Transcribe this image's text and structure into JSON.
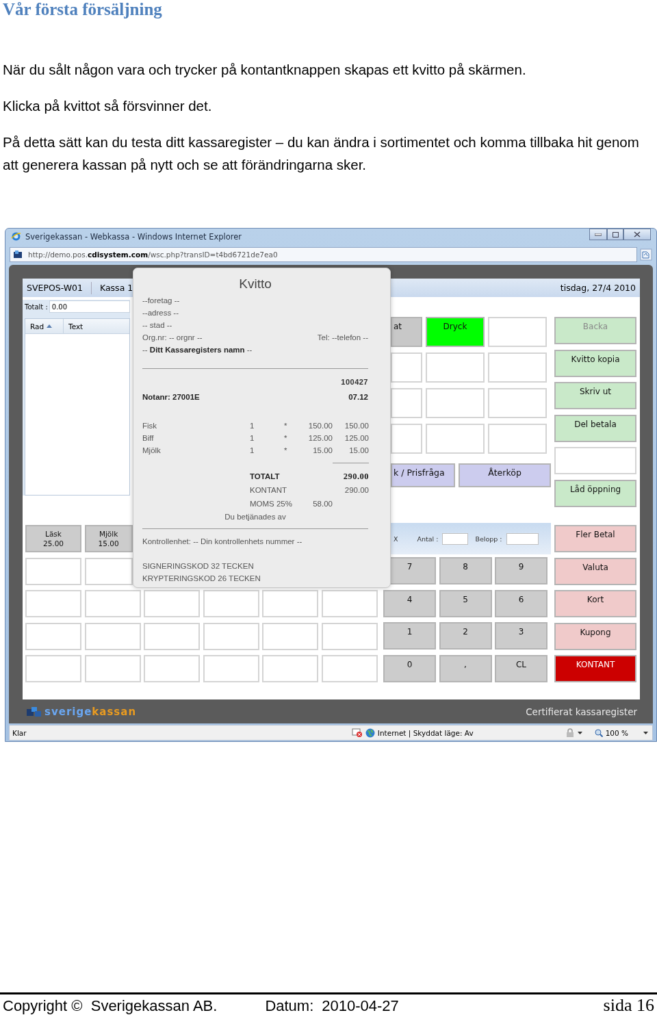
{
  "heading": "Vår första försäljning",
  "paragraphs": [
    "När du sålt någon vara och trycker på kontantknappen skapas ett kvitto på skärmen.",
    "Klicka på kvittot så försvinner det.",
    "På detta sätt kan du testa ditt kassaregister – du kan ändra i sortimentet och komma tillbaka hit genom att generera kassan på nytt och se att förändringarna sker."
  ],
  "browser": {
    "title": "Sverigekassan - Webkassa - Windows Internet Explorer",
    "address": "http://demo.pos.**cdisystem.com**/wsc.php?transID=t4bd6721de7ea0",
    "status": {
      "text": "Klar",
      "zone": "Internet | Skyddat läge: Av",
      "zoom": "100 %"
    }
  },
  "app": {
    "header": {
      "station": "SVEPOS-W01",
      "register": "Kassa 1",
      "date": "tisdag, 27/4 2010"
    },
    "total": {
      "label": "Totalt :",
      "value": "0.00"
    },
    "columns": [
      {
        "label": "Rad",
        "sorted": true
      },
      {
        "label": "Text",
        "sorted": false
      }
    ],
    "categories": [
      [
        {
          "label": "at",
          "kind": "category"
        },
        {
          "label": "Dryck",
          "kind": "active"
        },
        {
          "kind": "empty"
        }
      ],
      [
        {
          "kind": "empty"
        },
        {
          "kind": "empty"
        },
        {
          "kind": "empty"
        }
      ],
      [
        {
          "kind": "empty"
        },
        {
          "kind": "empty"
        },
        {
          "kind": "empty"
        }
      ],
      [
        {
          "kind": "empty"
        },
        {
          "kind": "empty"
        },
        {
          "kind": "empty"
        }
      ]
    ],
    "lookup_buttons": [
      "k / Prisfråga",
      "Återköp"
    ],
    "functions": [
      {
        "label": "Backa",
        "kind": "function",
        "disabled": true
      },
      {
        "label": "Kvitto kopia",
        "kind": "function",
        "disabled": false
      },
      {
        "label": "Skriv ut",
        "kind": "function",
        "disabled": false
      },
      {
        "label": "Del betala",
        "kind": "function",
        "disabled": false
      },
      {
        "kind": "empty"
      },
      {
        "label": "Låd öppning",
        "kind": "function",
        "disabled": false
      }
    ],
    "payments": [
      {
        "label": "Fler Betal",
        "kind": "payment"
      },
      {
        "label": "Valuta",
        "kind": "payment"
      },
      {
        "label": "Kort",
        "kind": "payment"
      },
      {
        "label": "Kupong",
        "kind": "payment"
      },
      {
        "label": "KONTANT",
        "kind": "cash"
      }
    ],
    "products": [
      [
        {
          "label": "Läsk",
          "price": "25.00",
          "kind": "product"
        },
        {
          "label": "Mjölk",
          "price": "15.00",
          "kind": "product"
        }
      ],
      [
        {
          "kind": "empty"
        },
        {
          "kind": "empty"
        }
      ],
      [
        {
          "kind": "empty"
        },
        {
          "kind": "empty"
        },
        {
          "kind": "empty"
        },
        {
          "kind": "empty"
        },
        {
          "kind": "empty"
        },
        {
          "kind": "empty"
        }
      ],
      [
        {
          "kind": "empty"
        },
        {
          "kind": "empty"
        },
        {
          "kind": "empty"
        },
        {
          "kind": "empty"
        },
        {
          "kind": "empty"
        },
        {
          "kind": "empty"
        }
      ],
      [
        {
          "kind": "empty"
        },
        {
          "kind": "empty"
        },
        {
          "kind": "empty"
        },
        {
          "kind": "empty"
        },
        {
          "kind": "empty"
        },
        {
          "kind": "empty"
        }
      ]
    ],
    "entry": {
      "multiply": "X",
      "quantity_label": "Antal :",
      "amount_label": "Belopp :"
    },
    "keypad": [
      "7",
      "8",
      "9",
      "4",
      "5",
      "6",
      "1",
      "2",
      "3",
      "0",
      ",",
      "CL"
    ],
    "bottom_bar": {
      "logo_first": "sverige",
      "logo_second": "kassan",
      "certified": "Certifierat kassaregister"
    }
  },
  "receipt": {
    "title": "Kvitto",
    "company_lines": [
      "--foretag --",
      "--adress --",
      "-- stad --"
    ],
    "org": "Org.nr: -- orgnr --",
    "phone": "Tel: --telefon --",
    "register_name": "-- **Ditt Kassaregisters namn** --",
    "date": "100427",
    "note": "Notanr: 27001E",
    "time": "07.12",
    "items": [
      {
        "name": "Fisk",
        "quantity": "1",
        "sign": "*",
        "price": "150.00",
        "total": "150.00"
      },
      {
        "name": "Biff",
        "quantity": "1",
        "sign": "*",
        "price": "125.00",
        "total": "125.00"
      },
      {
        "name": "Mjölk",
        "quantity": "1",
        "sign": "*",
        "price": "15.00",
        "total": "15.00"
      }
    ],
    "total_label": "TOTALT",
    "total": "290.00",
    "cash_label": "KONTANT",
    "cash": "290.00",
    "vat_label": "MOMS 25%",
    "vat": "58.00",
    "served": "Du betjänades av",
    "control_unit": "Kontrollenhet: -- Din kontrollenhets nummer --",
    "codes": [
      "SIGNERINGSKOD 32 TECKEN",
      "KRYPTERINGSKOD 26 TECKEN"
    ]
  },
  "footer": {
    "copyright": "Copyright ©  Sverigekassan AB.",
    "date_label": "Datum:",
    "date": "2010-04-27",
    "page": "sida 16"
  }
}
